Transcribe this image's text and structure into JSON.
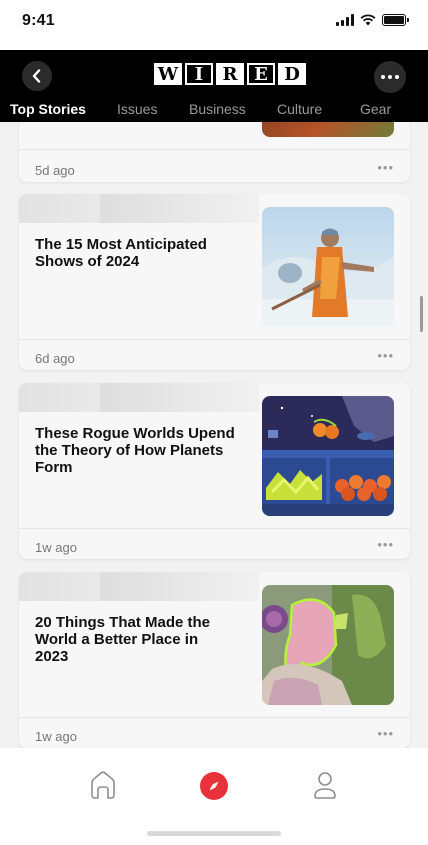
{
  "status_bar": {
    "time": "9:41"
  },
  "header": {
    "logo_letters": [
      "W",
      "I",
      "R",
      "E",
      "D"
    ],
    "tabs": [
      {
        "label": "Top Stories",
        "active": true
      },
      {
        "label": "Issues",
        "active": false
      },
      {
        "label": "Business",
        "active": false
      },
      {
        "label": "Culture",
        "active": false
      },
      {
        "label": "Gear",
        "active": false
      }
    ]
  },
  "feed": {
    "partial_card": {
      "time": "5d ago",
      "more": "•••"
    },
    "cards": [
      {
        "title": "The 15 Most Anticipated Shows of 2024",
        "time": "6d ago",
        "more": "•••",
        "image": "airbender-character-image"
      },
      {
        "title": "These Rogue Worlds Upend the Theory of How Planets Form",
        "time": "1w ago",
        "more": "•••",
        "image": "fruit-tray-illustration-image"
      },
      {
        "title": "20 Things That Made the World a Better Place in 2023",
        "time": "1w ago",
        "more": "•••",
        "image": "pink-collage-image"
      }
    ]
  },
  "bottom_nav": {
    "items": [
      {
        "icon": "home-icon",
        "active": false
      },
      {
        "icon": "compass-icon",
        "active": true
      },
      {
        "icon": "profile-icon",
        "active": false
      }
    ]
  },
  "colors": {
    "accent": "#e8313a",
    "header_bg": "#000000",
    "feed_bg": "#f2f2f2"
  }
}
